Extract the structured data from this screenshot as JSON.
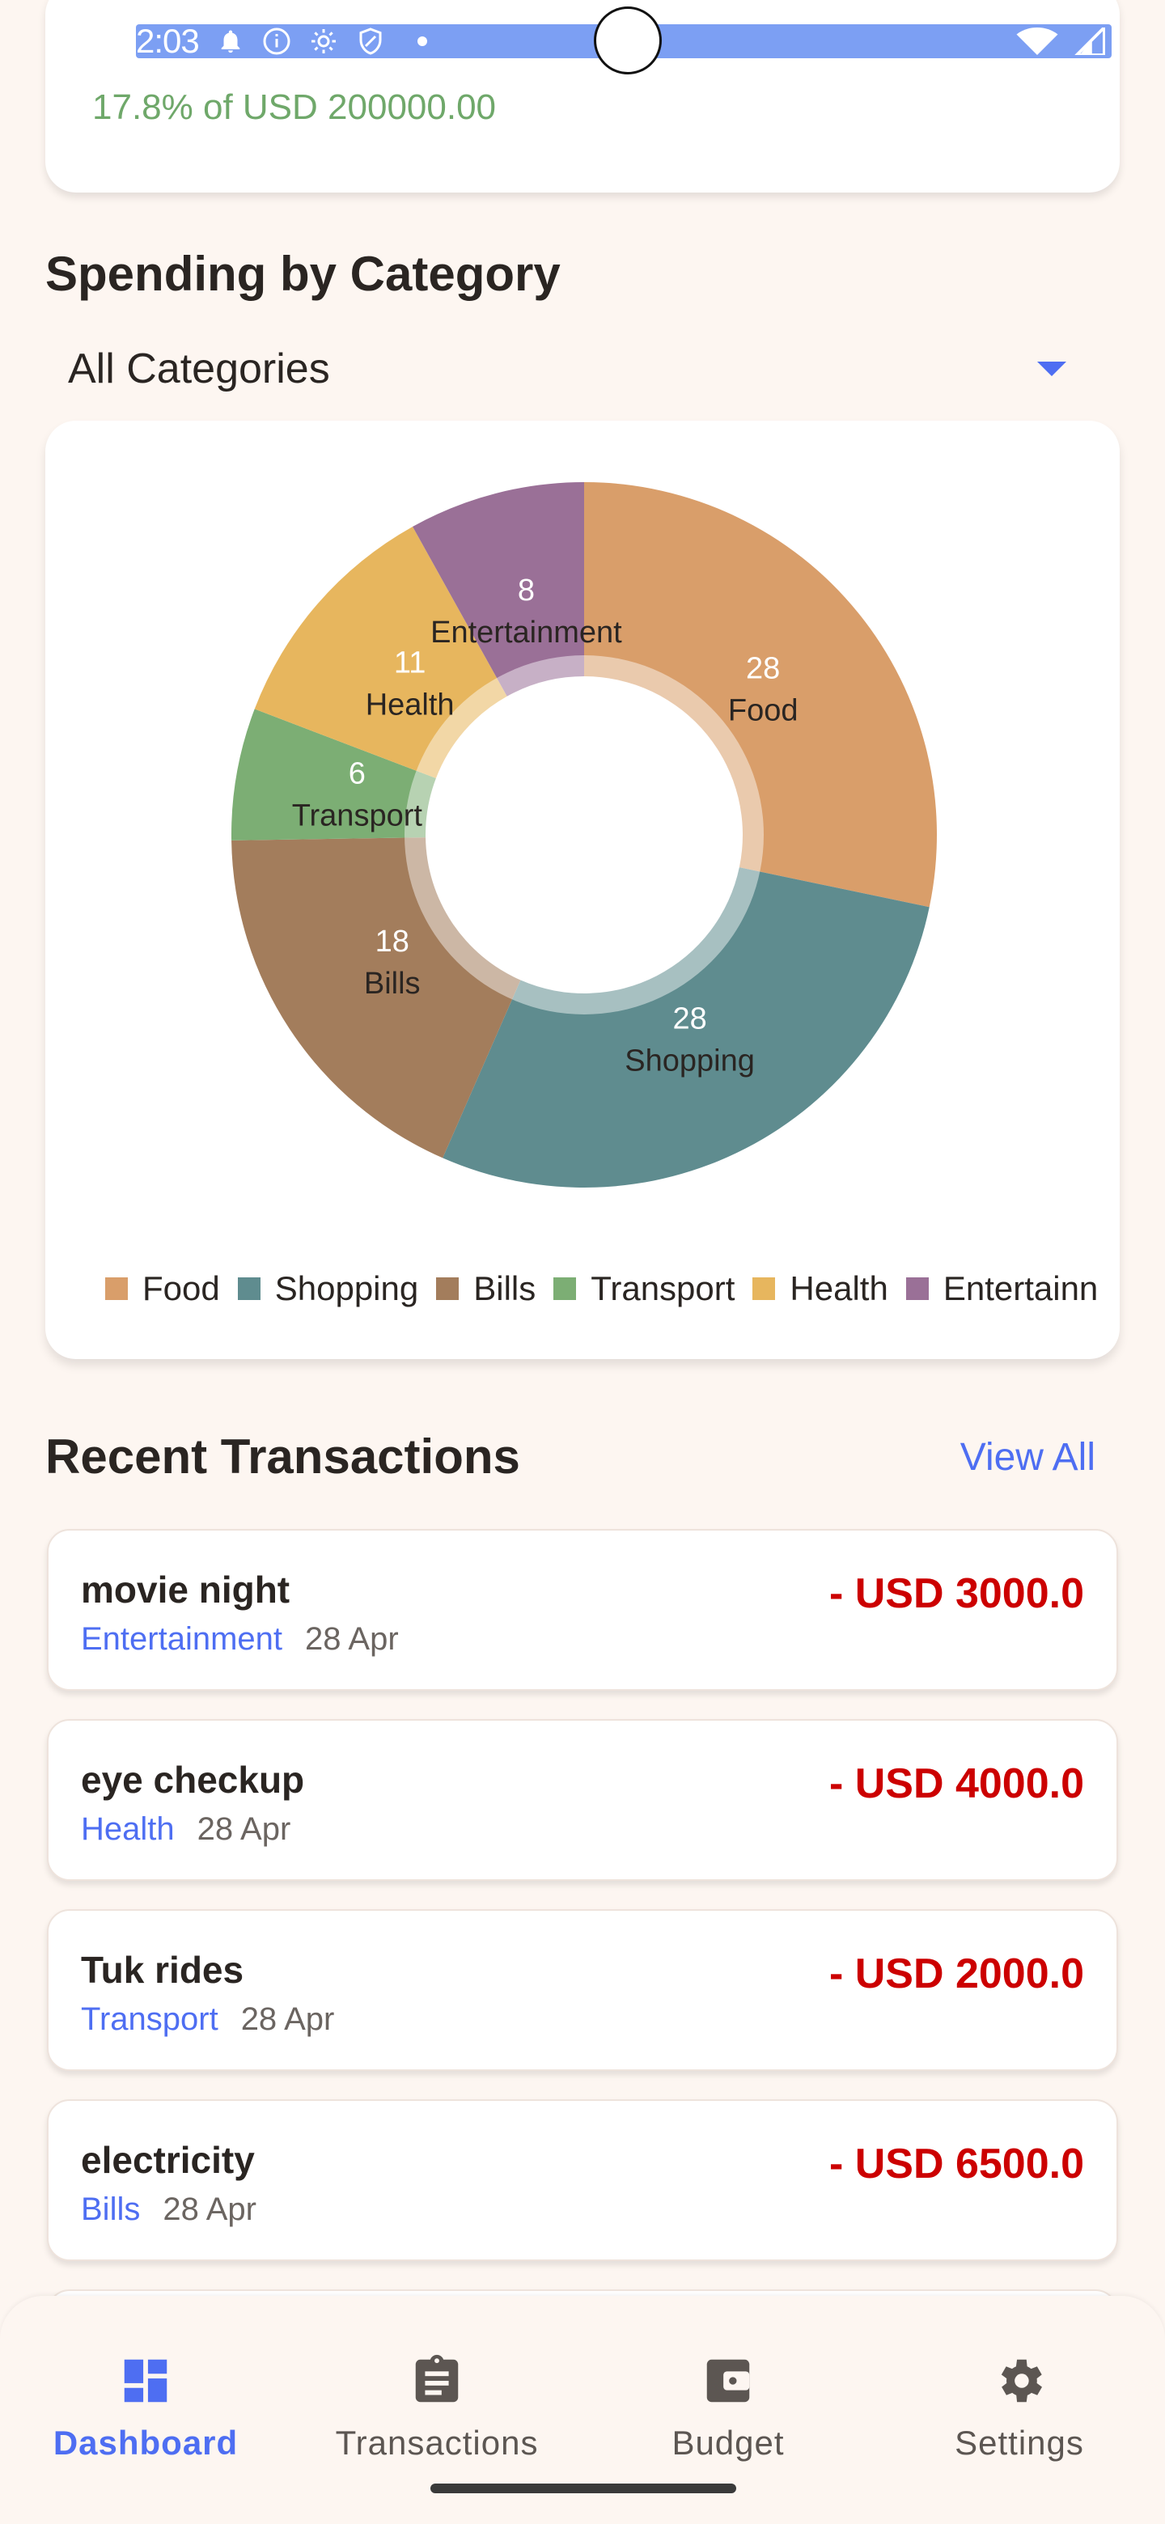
{
  "status_bar": {
    "time": "2:03"
  },
  "budget": {
    "percent_text": "17.8% of USD 200000.00"
  },
  "spending": {
    "title": "Spending by Category",
    "filter_selected": "All Categories"
  },
  "chart_data": {
    "type": "pie",
    "donut": true,
    "categories": [
      "Food",
      "Shopping",
      "Bills",
      "Transport",
      "Health",
      "Entertainment"
    ],
    "values": [
      28,
      28,
      18,
      6,
      11,
      8
    ],
    "colors": [
      "#d99e6a",
      "#5f8c8f",
      "#a37d5c",
      "#7cae74",
      "#e7b65e",
      "#9a7097"
    ],
    "legend_position": "bottom",
    "legend_labels": [
      "Food",
      "Shopping",
      "Bills",
      "Transport",
      "Health",
      "Entertainn"
    ]
  },
  "transactions": {
    "title": "Recent Transactions",
    "view_all_label": "View All",
    "items": [
      {
        "title": "movie night",
        "category": "Entertainment",
        "date": "28 Apr",
        "amount": "- USD 3000.0"
      },
      {
        "title": "eye checkup",
        "category": "Health",
        "date": "28 Apr",
        "amount": "- USD 4000.0"
      },
      {
        "title": "Tuk rides",
        "category": "Transport",
        "date": "28 Apr",
        "amount": "- USD 2000.0"
      },
      {
        "title": "electricity",
        "category": "Bills",
        "date": "28 Apr",
        "amount": "- USD 6500.0"
      }
    ]
  },
  "nav": {
    "items": [
      {
        "label": "Dashboard",
        "icon": "dashboard-icon",
        "active": true
      },
      {
        "label": "Transactions",
        "icon": "clipboard-icon",
        "active": false
      },
      {
        "label": "Budget",
        "icon": "wallet-icon",
        "active": false
      },
      {
        "label": "Settings",
        "icon": "gear-icon",
        "active": false
      }
    ],
    "active_color": "#4e6ef2",
    "inactive_color": "#5c5652"
  },
  "colors": {
    "accent": "#4e6ef2",
    "expense": "#cc0000",
    "budget_ok": "#6fa86a",
    "background": "#fdf6f1"
  }
}
